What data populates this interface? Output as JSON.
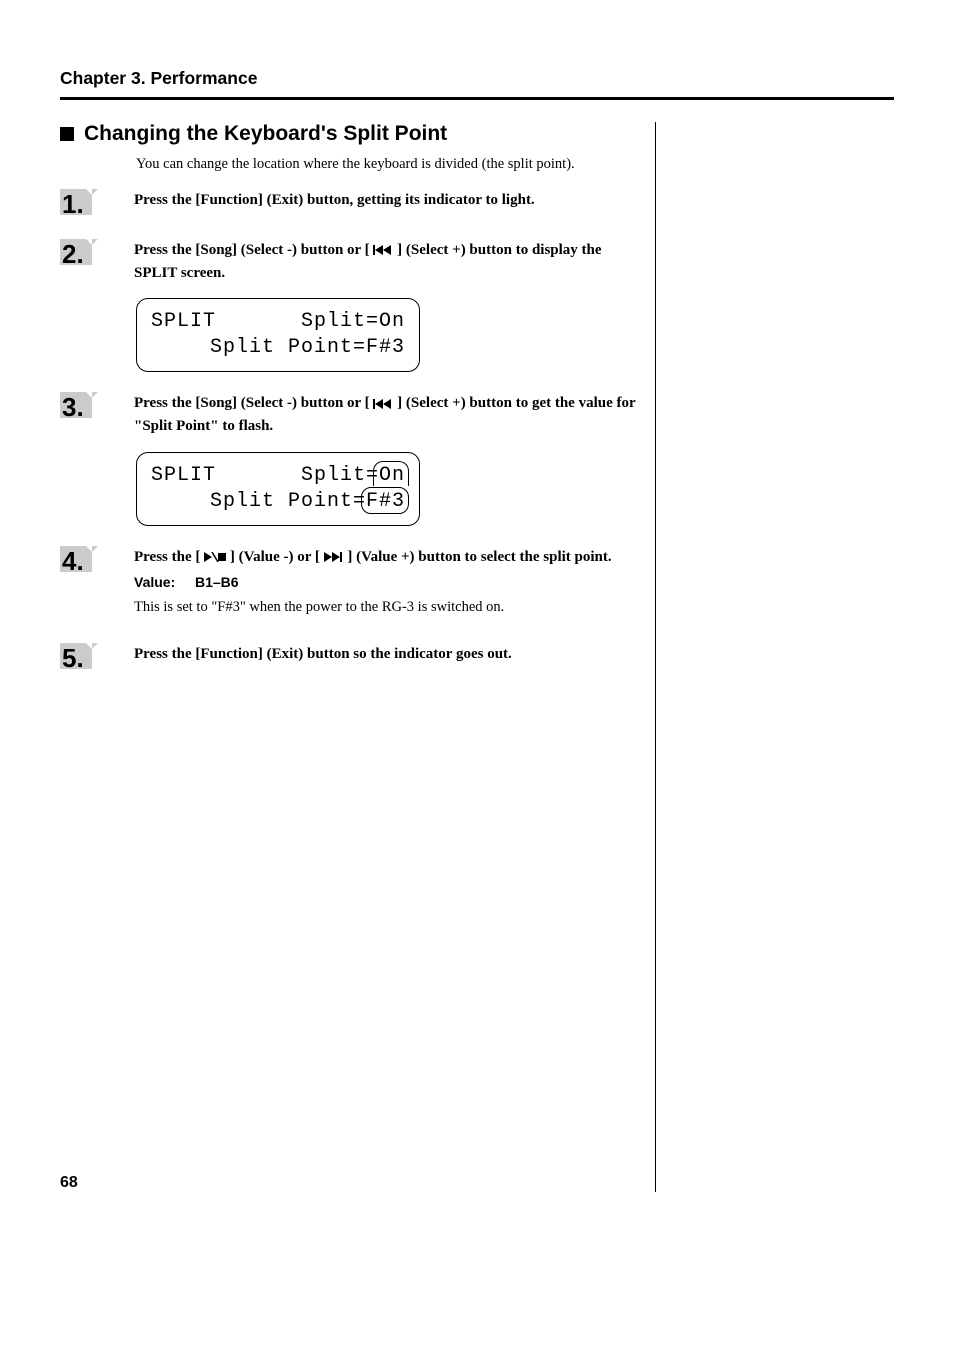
{
  "chapter_title": "Chapter 3. Performance",
  "section_title_prefix": "Changing the Keyboard's Split Point",
  "intro": "You can change the location where the keyboard is divided (the split point).",
  "steps": {
    "s1": {
      "num": "1.",
      "text_a": "Press the [Function] (Exit) button, getting its indicator to light."
    },
    "s2": {
      "num": "2.",
      "text_a": "Press the [Song] (Select -) button or [",
      "text_b": "] (Select +) button to display the SPLIT screen."
    },
    "s3": {
      "num": "3.",
      "text_a": "Press the [Song] (Select -) button or [",
      "text_b": "] (Select +) button to get the value for \"Split Point\" to flash."
    },
    "s4": {
      "num": "4.",
      "text_a": "Press the [",
      "text_b": "] (Value -) or [",
      "text_c": "] (Value +) button to select the split point.",
      "value_label": "Value:",
      "value_range": "B1–B6",
      "note": "This is set to \"F#3\" when the power to the RG-3 is switched on."
    },
    "s5": {
      "num": "5.",
      "text_a": "Press the [Function] (Exit) button so the indicator goes out."
    }
  },
  "lcd1": {
    "left": "SPLIT",
    "right": "Split=On",
    "line2": "Split Point=F#3"
  },
  "lcd2": {
    "left": "SPLIT",
    "right": "Split=On",
    "line2": "Split Point=F#3"
  },
  "page_number": "68"
}
